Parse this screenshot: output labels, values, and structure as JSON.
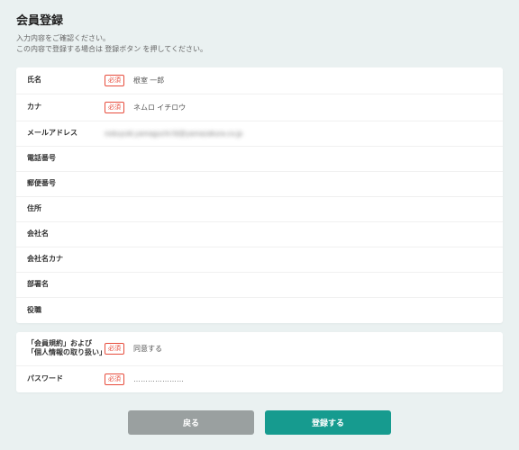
{
  "page": {
    "title": "会員登録",
    "subtitle_line1": "入力内容をご確認ください。",
    "subtitle_line2": "この内容で登録する場合は 登録ボタン を押してください。"
  },
  "required_badge": "必須",
  "fields": {
    "name": {
      "label": "氏名",
      "required": true,
      "value": "根室 一郎"
    },
    "kana": {
      "label": "カナ",
      "required": true,
      "value": "ネムロ イチロウ"
    },
    "email": {
      "label": "メールアドレス",
      "required": false,
      "value": "nobuyuki.yamaguchi-fd@yamazakura.co.jp",
      "blurred": true
    },
    "phone": {
      "label": "電話番号",
      "required": false,
      "value": ""
    },
    "postal": {
      "label": "郵便番号",
      "required": false,
      "value": ""
    },
    "address": {
      "label": "住所",
      "required": false,
      "value": ""
    },
    "company": {
      "label": "会社名",
      "required": false,
      "value": ""
    },
    "company_kana": {
      "label": "会社名カナ",
      "required": false,
      "value": ""
    },
    "department": {
      "label": "部署名",
      "required": false,
      "value": ""
    },
    "position": {
      "label": "役職",
      "required": false,
      "value": ""
    }
  },
  "agreement": {
    "terms": {
      "label": "「会員規約」および「個人情報の取り扱い」",
      "required": true,
      "value": "同意する"
    },
    "password": {
      "label": "パスワード",
      "required": true,
      "value": "…………………"
    }
  },
  "buttons": {
    "back": "戻る",
    "submit": "登録する"
  }
}
